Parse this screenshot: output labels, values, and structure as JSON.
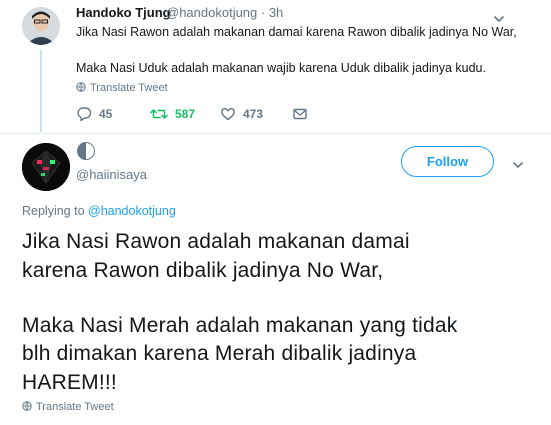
{
  "parent_tweet": {
    "author_name": "Handoko Tjung",
    "author_handle": "@handokotjung · 3h",
    "text_line1": "Jika Nasi Rawon adalah makanan damai karena Rawon dibalik jadinya No War,",
    "text_line2": "Maka Nasi Uduk adalah makanan wajib karena Uduk dibalik jadinya kudu.",
    "translate_label": "Translate Tweet",
    "replies": "45",
    "retweets": "587",
    "likes": "473"
  },
  "main_tweet": {
    "author_handle": "@haiinisaya",
    "follow_label": "Follow",
    "replying_prefix": "Replying to ",
    "replying_to": "@handokotjung",
    "lines": [
      "Jika Nasi Rawon adalah makanan damai",
      "karena Rawon dibalik jadinya No War,",
      "Maka Nasi Merah adalah makanan yang tidak",
      "blh dimakan karena Merah dibalik jadinya",
      "HAREM!!!"
    ],
    "translate_label": "Translate Tweet"
  },
  "colors": {
    "brand_blue": "#1da1f2",
    "retweet_green": "#17bf63",
    "secondary_text": "#657786",
    "thread_line": "#c4e3f6"
  },
  "icons": {
    "reply": "reply-icon",
    "retweet": "retweet-icon",
    "like": "heart-icon",
    "dm": "envelope-icon",
    "more": "chevron-down-icon",
    "translate": "globe-icon"
  }
}
